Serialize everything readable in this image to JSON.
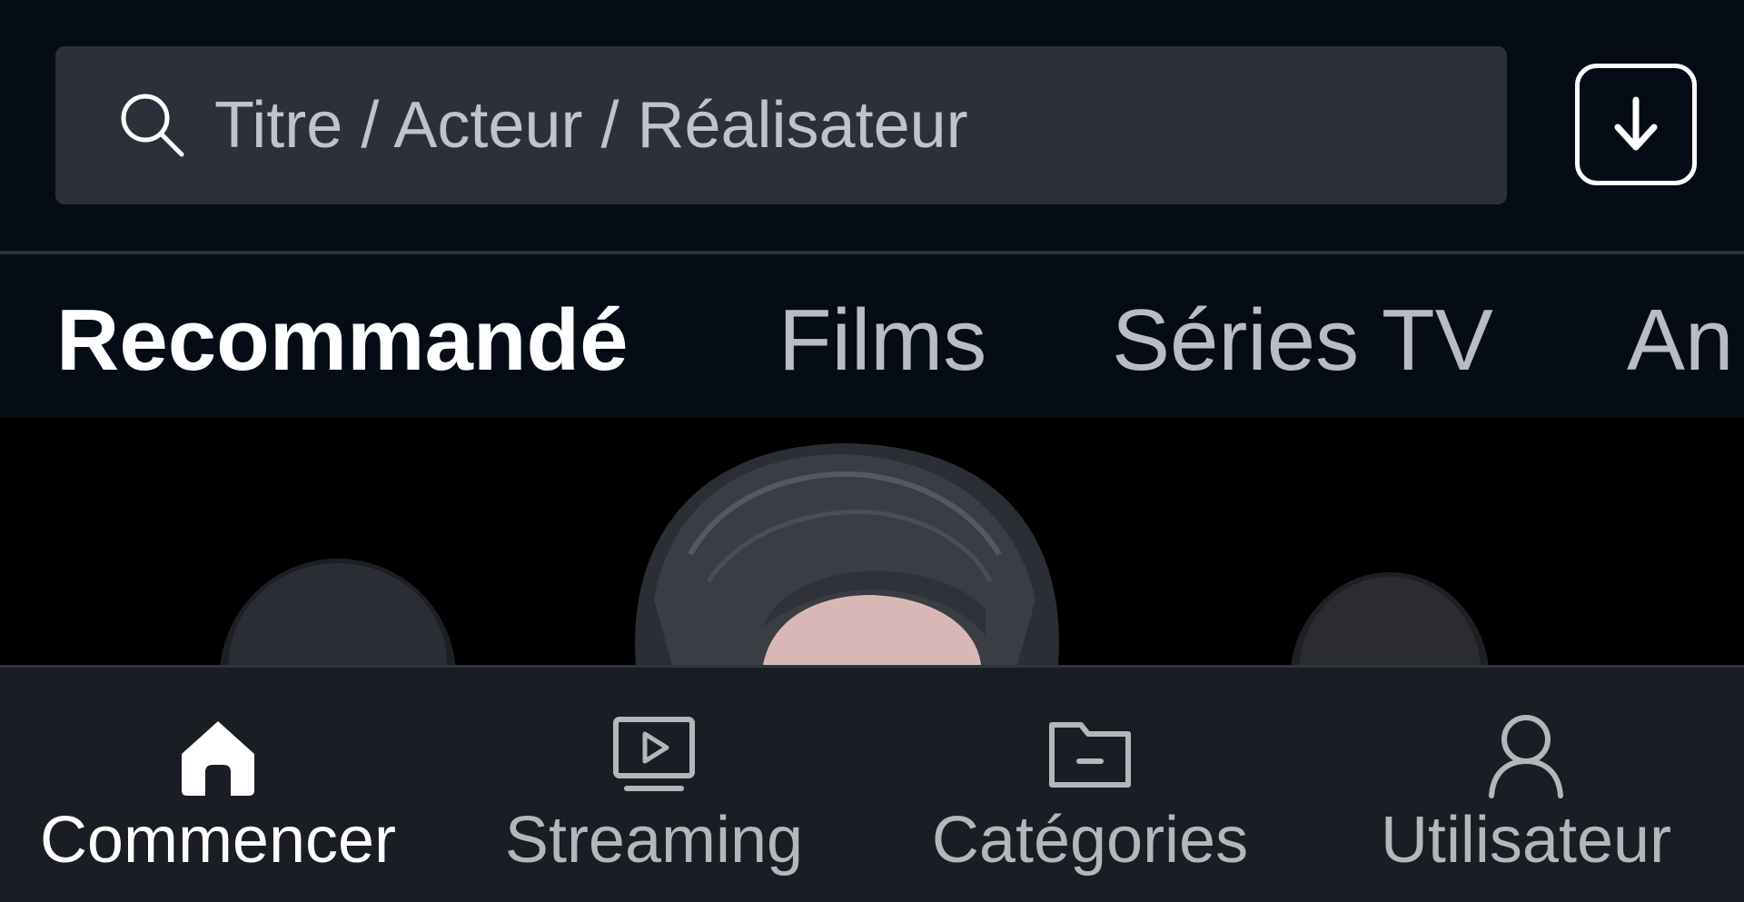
{
  "search": {
    "placeholder": "Titre / Acteur / Réalisateur",
    "icon": "search-icon"
  },
  "download": {
    "icon": "download-icon"
  },
  "tabs": [
    {
      "label": "Recommandé",
      "active": true
    },
    {
      "label": "Films",
      "active": false
    },
    {
      "label": "Séries TV",
      "active": false
    },
    {
      "label": "An",
      "active": false
    }
  ],
  "bottom_nav": [
    {
      "label": "Commencer",
      "icon": "home-icon",
      "active": true
    },
    {
      "label": "Streaming",
      "icon": "tv-play-icon",
      "active": false
    },
    {
      "label": "Catégories",
      "icon": "folder-icon",
      "active": false
    },
    {
      "label": "Utilisateur",
      "icon": "user-icon",
      "active": false
    }
  ],
  "colors": {
    "background": "#050c15",
    "search_bg": "#2b3039",
    "nav_bg": "#1a1d23",
    "active_text": "#ffffff",
    "inactive_text": "#b9bdc3"
  }
}
